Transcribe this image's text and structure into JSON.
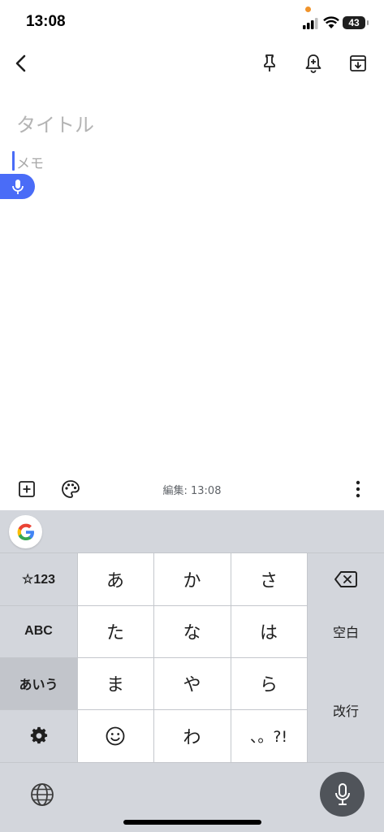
{
  "status_bar": {
    "time": "13:08",
    "battery": "43"
  },
  "header": {
    "back_icon": "chevron-left-icon",
    "pin_icon": "pin-icon",
    "reminder_icon": "bell-plus-icon",
    "archive_icon": "archive-icon"
  },
  "note": {
    "title_placeholder": "タイトル",
    "memo_placeholder": "メモ"
  },
  "bottom_bar": {
    "edited_label": "編集: 13:08"
  },
  "keyboard": {
    "left_keys": [
      "☆123",
      "ABC",
      "あいう"
    ],
    "rows": [
      [
        "あ",
        "か",
        "さ"
      ],
      [
        "た",
        "な",
        "は"
      ],
      [
        "ま",
        "や",
        "ら"
      ],
      [
        "☺",
        "わ",
        "、。?!"
      ]
    ],
    "space_label": "空白",
    "enter_label": "改行"
  },
  "colors": {
    "accent": "#4a6cf7",
    "keyboard_bg": "#d3d6dc",
    "mic_bg": "#50545a"
  }
}
